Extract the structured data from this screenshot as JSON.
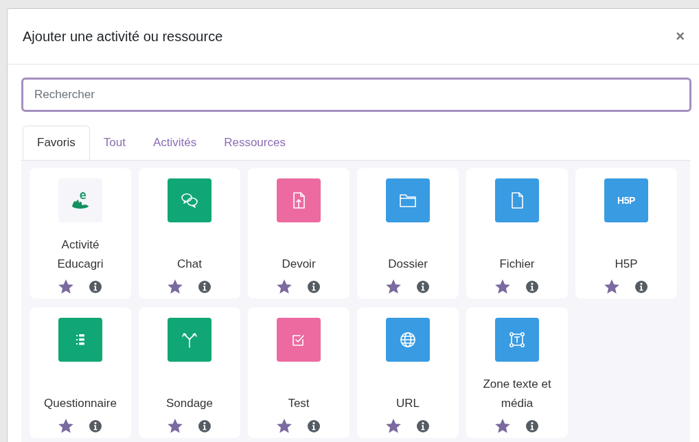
{
  "dialog": {
    "title": "Ajouter une activité ou ressource",
    "close": "×",
    "search": {
      "placeholder": "Rechercher"
    },
    "tabs": [
      {
        "label": "Favoris",
        "selected": true
      },
      {
        "label": "Tout",
        "selected": false
      },
      {
        "label": "Activités",
        "selected": false
      },
      {
        "label": "Ressources",
        "selected": false
      }
    ],
    "items": [
      {
        "kind": "educagri",
        "name": "Activité Educagri",
        "color": "#f5f5fa",
        "starred": true
      },
      {
        "kind": "chat",
        "name": "Chat",
        "color": "#11a676",
        "starred": true
      },
      {
        "kind": "assignment",
        "name": "Devoir",
        "color": "#ec6aa0",
        "starred": true
      },
      {
        "kind": "folder",
        "name": "Dossier",
        "color": "#399be2",
        "starred": true
      },
      {
        "kind": "file",
        "name": "Fichier",
        "color": "#399be2",
        "starred": true
      },
      {
        "kind": "h5p",
        "name": "H5P",
        "color": "#399be2",
        "starred": true,
        "logo": "H5P"
      },
      {
        "kind": "list",
        "name": "Questionnaire",
        "color": "#11a676",
        "starred": true
      },
      {
        "kind": "fork",
        "name": "Sondage",
        "color": "#11a676",
        "starred": true
      },
      {
        "kind": "check",
        "name": "Test",
        "color": "#ec6aa0",
        "starred": true
      },
      {
        "kind": "globe",
        "name": "URL",
        "color": "#399be2",
        "starred": true
      },
      {
        "kind": "textbox",
        "name": "Zone texte et média",
        "color": "#399be2",
        "starred": true
      }
    ]
  }
}
